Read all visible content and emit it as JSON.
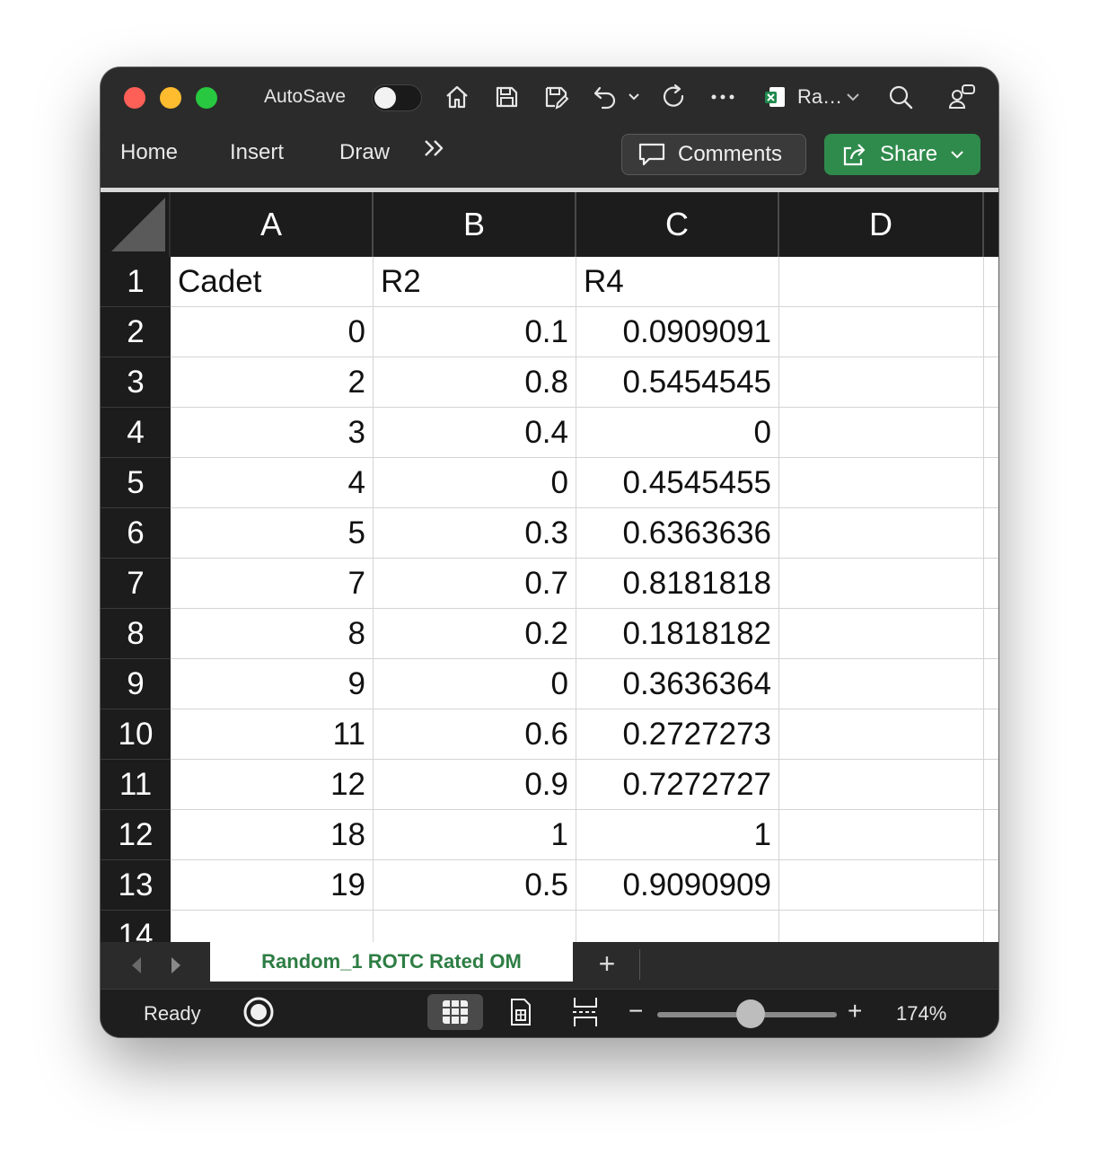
{
  "toolbar": {
    "autosave_label": "AutoSave",
    "doc_name": "Ra…",
    "comments_label": "Comments",
    "share_label": "Share"
  },
  "ribbon": {
    "tabs": [
      "Home",
      "Insert",
      "Draw"
    ],
    "more_label": ">>"
  },
  "sheet": {
    "columns": [
      "A",
      "B",
      "C",
      "D"
    ],
    "row_numbers": [
      "1",
      "2",
      "3",
      "4",
      "5",
      "6",
      "7",
      "8",
      "9",
      "10",
      "11",
      "12",
      "13",
      "14"
    ],
    "header_row": [
      "Cadet",
      "R2",
      "R4"
    ],
    "rows": [
      [
        "0",
        "0.1",
        "0.0909091"
      ],
      [
        "2",
        "0.8",
        "0.5454545"
      ],
      [
        "3",
        "0.4",
        "0"
      ],
      [
        "4",
        "0",
        "0.4545455"
      ],
      [
        "5",
        "0.3",
        "0.6363636"
      ],
      [
        "7",
        "0.7",
        "0.8181818"
      ],
      [
        "8",
        "0.2",
        "0.1818182"
      ],
      [
        "9",
        "0",
        "0.3636364"
      ],
      [
        "11",
        "0.6",
        "0.2727273"
      ],
      [
        "12",
        "0.9",
        "0.7272727"
      ],
      [
        "18",
        "1",
        "1"
      ],
      [
        "19",
        "0.5",
        "0.9090909"
      ]
    ]
  },
  "tabs": {
    "sheet_name": "Random_1 ROTC Rated OM",
    "add_label": "+"
  },
  "status": {
    "text": "Ready",
    "zoom_minus": "−",
    "zoom_plus": "+",
    "zoom": "174%",
    "zoom_fraction": 0.52
  },
  "colors": {
    "share": "#2f8b4c",
    "sheet_tab_text": "#2e7d44",
    "traffic_red": "#fe5f57",
    "traffic_yellow": "#febc2e",
    "traffic_green": "#28c840"
  }
}
